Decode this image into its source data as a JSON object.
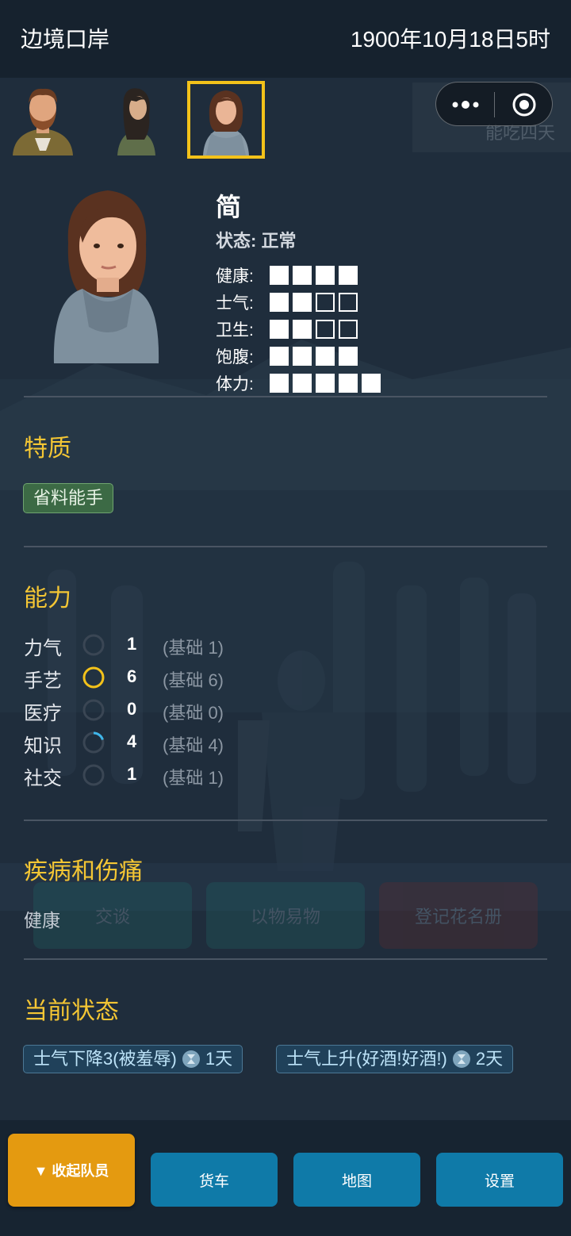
{
  "header": {
    "title": "边境口岸",
    "datetime": "1900年10月18日5时"
  },
  "background": {
    "ghost_tag": "能吃四天",
    "ghost_buttons": [
      "交谈",
      "以物易物",
      "登记花名册"
    ]
  },
  "party": {
    "selected_index": 2,
    "members": [
      "member-1",
      "member-2",
      "member-3"
    ]
  },
  "character": {
    "name": "简",
    "status": "状态: 正常",
    "stats": [
      {
        "label": "健康:",
        "filled": 4,
        "total": 4
      },
      {
        "label": "士气:",
        "filled": 2,
        "total": 4
      },
      {
        "label": "卫生:",
        "filled": 2,
        "total": 4
      },
      {
        "label": "饱腹:",
        "filled": 4,
        "total": 4
      },
      {
        "label": "体力:",
        "filled": 5,
        "total": 5
      }
    ]
  },
  "traits": {
    "title": "特质",
    "items": [
      "省料能手"
    ]
  },
  "abilities": {
    "title": "能力",
    "items": [
      {
        "name": "力气",
        "value": "1",
        "base": "(基础 1)",
        "progress": 0
      },
      {
        "name": "手艺",
        "value": "6",
        "base": "(基础 6)",
        "progress": 1
      },
      {
        "name": "医疗",
        "value": "0",
        "base": "(基础 0)",
        "progress": 0
      },
      {
        "name": "知识",
        "value": "4",
        "base": "(基础 4)",
        "progress": 0.2
      },
      {
        "name": "社交",
        "value": "1",
        "base": "(基础 1)",
        "progress": 0
      }
    ]
  },
  "illness": {
    "title": "疾病和伤痛",
    "value": "健康"
  },
  "current_status": {
    "title": "当前状态",
    "items": [
      {
        "text": "士气下降3(被羞辱)",
        "duration": "1天"
      },
      {
        "text": "士气上升(好酒!好酒!)",
        "duration": "2天"
      }
    ]
  },
  "bottom": {
    "collapse": "▼ 收起队员",
    "truck": "货车",
    "map": "地图",
    "settings": "设置"
  },
  "colors": {
    "accent": "#f3c21a",
    "button": "#0f7aa8",
    "collapse": "#e49a10",
    "trait": "#3c6a45"
  }
}
